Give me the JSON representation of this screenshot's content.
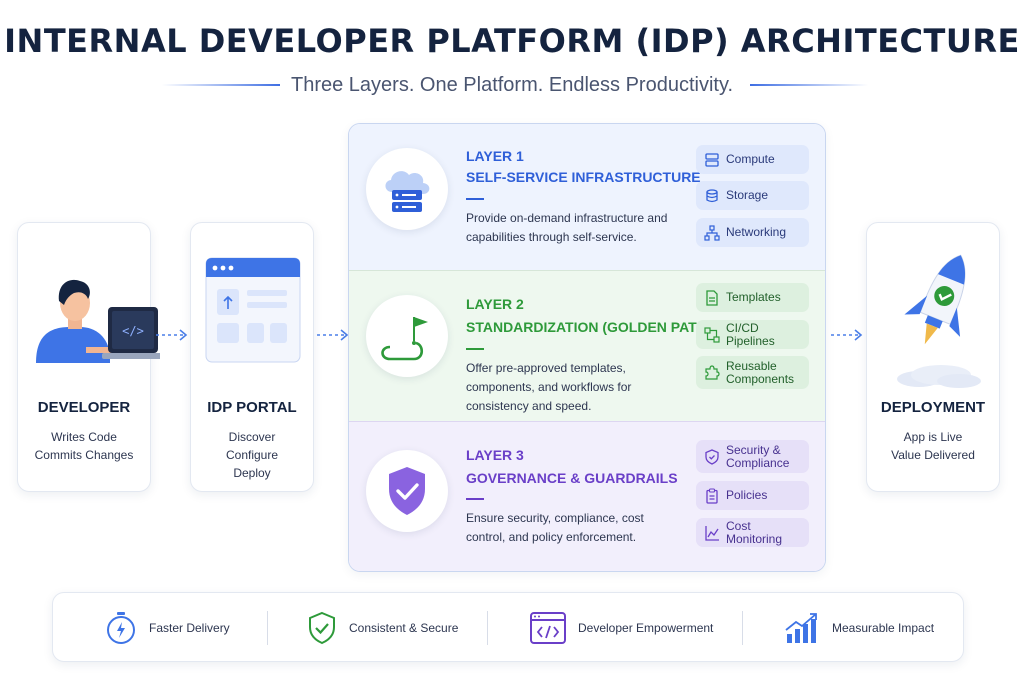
{
  "header": {
    "title": "INTERNAL DEVELOPER PLATFORM (IDP) ARCHITECTURE",
    "subtitle": "Three Layers. One Platform. Endless Productivity."
  },
  "developer": {
    "title": "DEVELOPER",
    "lines": [
      "Writes Code",
      "Commits Changes"
    ]
  },
  "portal": {
    "title": "IDP PORTAL",
    "lines": [
      "Discover",
      "Configure",
      "Deploy"
    ]
  },
  "layers": [
    {
      "number": "LAYER 1",
      "name": "SELF-SERVICE INFRASTRUCTURE",
      "description": "Provide on-demand infrastructure and capabilities through self-service.",
      "color": "#2f5fd8",
      "items": [
        {
          "label": "Compute",
          "icon": "server-icon"
        },
        {
          "label": "Storage",
          "icon": "database-icon"
        },
        {
          "label": "Networking",
          "icon": "network-icon"
        }
      ]
    },
    {
      "number": "LAYER 2",
      "name": "STANDARDIZATION (GOLDEN PATHS)",
      "description": "Offer pre-approved templates, components, and workflows for consistency and speed.",
      "color": "#2e9a3a",
      "items": [
        {
          "label": "Templates",
          "icon": "document-icon"
        },
        {
          "label": "CI/CD Pipelines",
          "icon": "pipeline-icon"
        },
        {
          "label": "Reusable Components",
          "icon": "puzzle-icon"
        }
      ]
    },
    {
      "number": "LAYER 3",
      "name": "GOVERNANCE & GUARDRAILS",
      "description": "Ensure security, compliance, cost control, and policy enforcement.",
      "color": "#6a3fc8",
      "items": [
        {
          "label": "Security & Compliance",
          "icon": "shield-icon"
        },
        {
          "label": "Policies",
          "icon": "clipboard-icon"
        },
        {
          "label": "Cost Monitoring",
          "icon": "chart-icon"
        }
      ]
    }
  ],
  "deployment": {
    "title": "DEPLOYMENT",
    "lines": [
      "App is Live",
      "Value Delivered"
    ]
  },
  "benefits": [
    {
      "label": "Faster Delivery",
      "icon": "stopwatch-icon"
    },
    {
      "label": "Consistent & Secure",
      "icon": "shield-check-icon"
    },
    {
      "label": "Developer Empowerment",
      "icon": "code-window-icon"
    },
    {
      "label": "Measurable Impact",
      "icon": "growth-chart-icon"
    }
  ],
  "colors": {
    "blue": "#2f5fd8",
    "green": "#2e9a3a",
    "purple": "#6a3fc8",
    "navy": "#14233f"
  }
}
